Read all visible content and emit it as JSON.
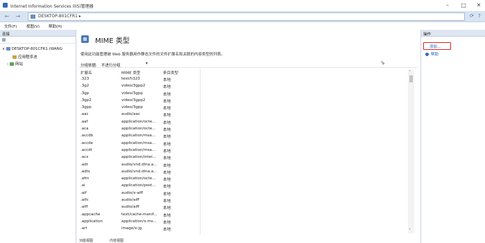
{
  "window": {
    "title": "Internet Information Services (IIS)管理器",
    "minimize": "–",
    "maximize": "□",
    "close": "✕"
  },
  "address": {
    "path": "DESKTOP-801CFR1  ▸"
  },
  "menu": [
    "文件(F)",
    "视图(V)",
    "帮助(H)"
  ],
  "left": {
    "header": "连接",
    "tree": [
      {
        "label": "DESKTOP-801CFR1 (WANG"
      },
      {
        "label": "应用程序池"
      },
      {
        "label": "网站"
      }
    ]
  },
  "main": {
    "title": "MIME 类型",
    "description": "使用此功能管理被 Web 服务器用作静态文件的文件扩展名和关联的内容类型的列表。",
    "group_label": "分组依据:",
    "group_value": "不进行分组",
    "columns": [
      "扩展名",
      "MIME 类型",
      "条目类型"
    ],
    "rows": [
      [
        ".323",
        "text/h323",
        "本地"
      ],
      [
        ".3g2",
        "video/3gpp2",
        "本地"
      ],
      [
        ".3gp",
        "video/3gpp",
        "本地"
      ],
      [
        ".3gp2",
        "video/3gpp2",
        "本地"
      ],
      [
        ".3gpp",
        "video/3gpp",
        "本地"
      ],
      [
        ".aac",
        "audio/aac",
        "本地"
      ],
      [
        ".aaf",
        "application/octe...",
        "本地"
      ],
      [
        ".aca",
        "application/octe...",
        "本地"
      ],
      [
        ".accdb",
        "application/msa...",
        "本地"
      ],
      [
        ".accde",
        "application/msa...",
        "本地"
      ],
      [
        ".accdt",
        "application/msa...",
        "本地"
      ],
      [
        ".acx",
        "application/inter...",
        "本地"
      ],
      [
        ".adt",
        "audio/vnd.dlna.a...",
        "本地"
      ],
      [
        ".adts",
        "audio/vnd.dlna.a...",
        "本地"
      ],
      [
        ".afm",
        "application/octe...",
        "本地"
      ],
      [
        ".ai",
        "application/post...",
        "本地"
      ],
      [
        ".aif",
        "audio/x-aiff",
        "本地"
      ],
      [
        ".aifc",
        "audio/aiff",
        "本地"
      ],
      [
        ".aiff",
        "audio/aiff",
        "本地"
      ],
      [
        ".appcache",
        "text/cache-manif...",
        "本地"
      ],
      [
        ".application",
        "application/x-ms...",
        "本地"
      ],
      [
        ".art",
        "image/x-jg",
        "本地"
      ]
    ],
    "tabs": [
      "功能视图",
      "内容视图"
    ]
  },
  "right": {
    "header": "操作",
    "actions": [
      "添加...",
      "帮助"
    ]
  }
}
